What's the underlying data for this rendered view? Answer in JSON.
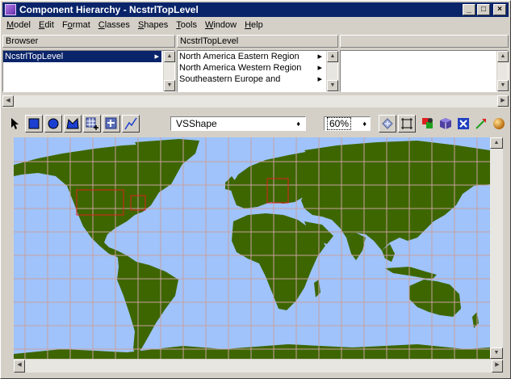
{
  "window": {
    "title": "Component Hierarchy - NcstrlTopLevel",
    "buttons": [
      "minimize",
      "maximize",
      "close"
    ]
  },
  "menu": [
    {
      "pre": "",
      "u": "M",
      "post": "odel"
    },
    {
      "pre": "",
      "u": "E",
      "post": "dit"
    },
    {
      "pre": "F",
      "u": "o",
      "post": "rmat"
    },
    {
      "pre": "",
      "u": "C",
      "post": "lasses"
    },
    {
      "pre": "",
      "u": "S",
      "post": "hapes"
    },
    {
      "pre": "",
      "u": "T",
      "post": "ools"
    },
    {
      "pre": "",
      "u": "W",
      "post": "indow"
    },
    {
      "pre": "",
      "u": "H",
      "post": "elp"
    }
  ],
  "browser": {
    "col1": {
      "header": "Browser",
      "items": [
        {
          "label": "NcstrlTopLevel",
          "arrow": "▸",
          "selected": true
        }
      ]
    },
    "col2": {
      "header": "NcstrlTopLevel",
      "items": [
        {
          "label": "North America Eastern Region",
          "arrow": "▸"
        },
        {
          "label": "North America Western Region",
          "arrow": "▸"
        },
        {
          "label": "Southeastern Europe and",
          "arrow": "▸"
        }
      ]
    },
    "col3": {
      "header": "",
      "items": []
    }
  },
  "toolbar": {
    "shape_select": "VSShape",
    "zoom": "60%",
    "tools": [
      "pointer-icon",
      "rectangle-icon",
      "ellipse-icon",
      "polygon-icon",
      "grid-add-icon",
      "grid-insert-icon",
      "polyline-icon"
    ],
    "right_tools": [
      "move-icon",
      "frame-icon",
      "shapes-color-icon",
      "cube-icon",
      "box-x-icon",
      "arrow-line-icon",
      "sphere-icon"
    ]
  },
  "colors": {
    "water": "#9fc3fa",
    "land": "#3d6600",
    "grid": "#c8a0a0",
    "region": "#e02020",
    "selection": "#0a246a"
  }
}
